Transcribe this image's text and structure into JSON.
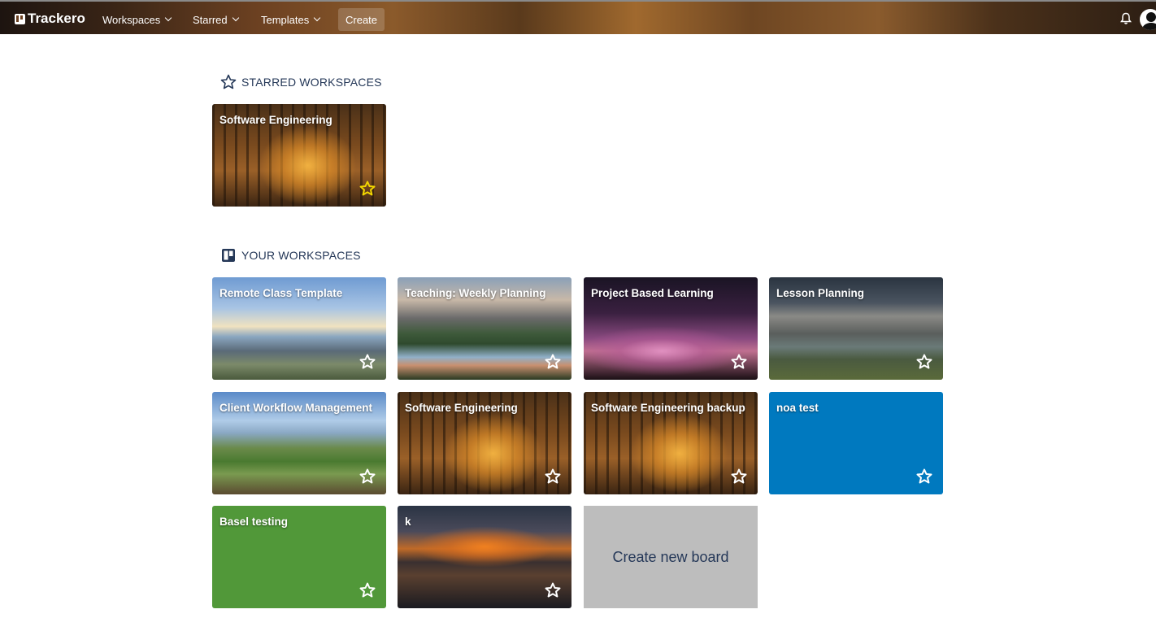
{
  "header": {
    "logo_text": "Trackero",
    "nav": {
      "workspaces": "Workspaces",
      "starred": "Starred",
      "templates": "Templates",
      "create": "Create"
    }
  },
  "starred_section": {
    "title": "STARRED WORKSPACES",
    "boards": [
      {
        "title": "Software Engineering",
        "starred": true
      }
    ]
  },
  "your_section": {
    "title": "YOUR WORKSPACES",
    "boards": [
      {
        "title": "Remote Class Template",
        "starred": false
      },
      {
        "title": "Teaching: Weekly Planning",
        "starred": false
      },
      {
        "title": "Project Based Learning",
        "starred": false
      },
      {
        "title": "Lesson Planning",
        "starred": false
      },
      {
        "title": "Client Workflow Management",
        "starred": false
      },
      {
        "title": "Software Engineering",
        "starred": false
      },
      {
        "title": "Software Engineering backup",
        "starred": false
      },
      {
        "title": "noa test",
        "starred": false
      },
      {
        "title": "Basel testing",
        "starred": false
      },
      {
        "title": "k",
        "starred": false
      }
    ],
    "create_label": "Create new board"
  },
  "colors": {
    "starred_star": "#f2d600",
    "blue_tile": "#0079bf",
    "green_tile": "#519839",
    "create_tile": "#bdbdbd",
    "section_text": "#253858"
  }
}
